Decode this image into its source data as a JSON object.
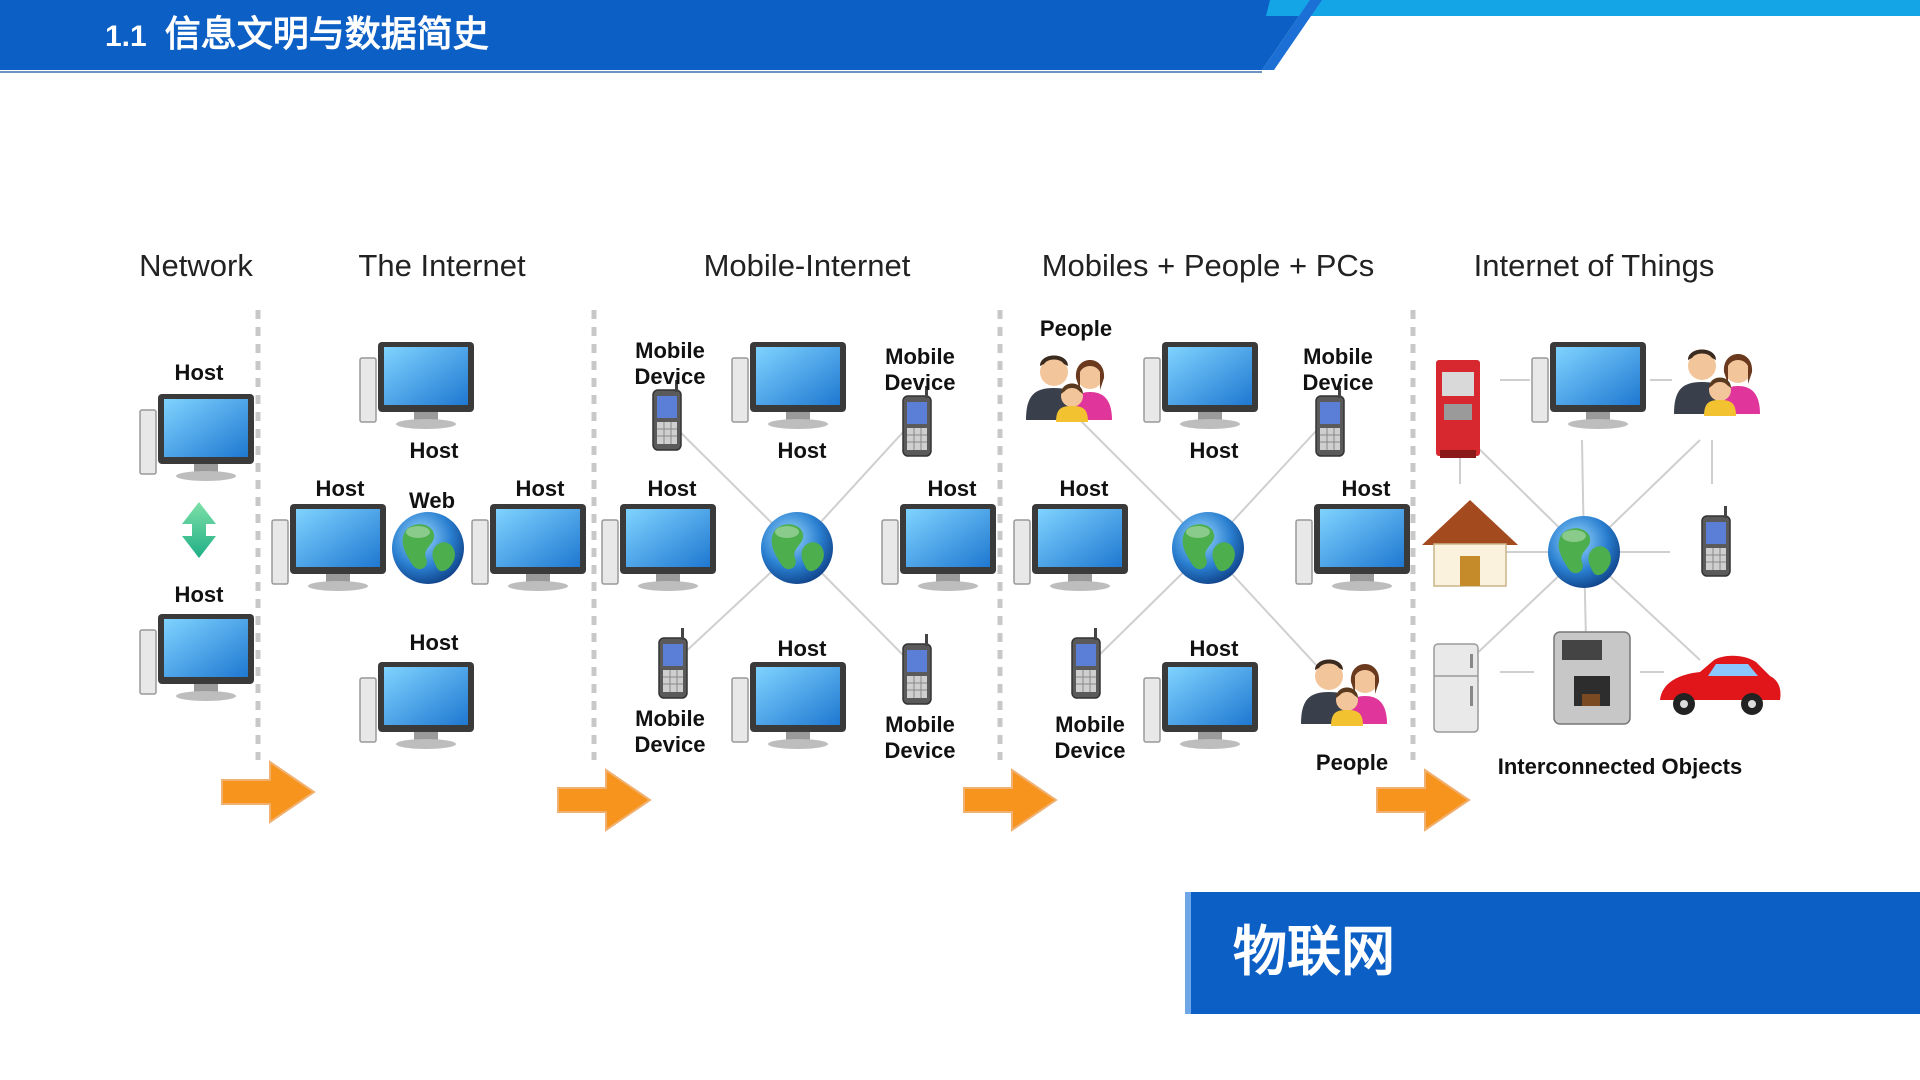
{
  "header": {
    "section_number": "1.1",
    "title": "信息文明与数据简史"
  },
  "stages": [
    {
      "title": "Network"
    },
    {
      "title": "The Internet"
    },
    {
      "title": "Mobile-Internet"
    },
    {
      "title": "Mobiles + People + PCs"
    },
    {
      "title": "Internet of Things"
    }
  ],
  "labels": {
    "host": "Host",
    "web": "Web",
    "mobile_device": [
      "Mobile",
      "Device"
    ],
    "people": "People",
    "interconnected_objects": "Interconnected Objects"
  },
  "footer": {
    "text": "物联网"
  },
  "colors": {
    "header_blue": "#0c5fc4",
    "accent_cyan": "#14a5e6",
    "arrow_orange": "#f7941d",
    "teal_arrow": "#2fbf9a"
  }
}
